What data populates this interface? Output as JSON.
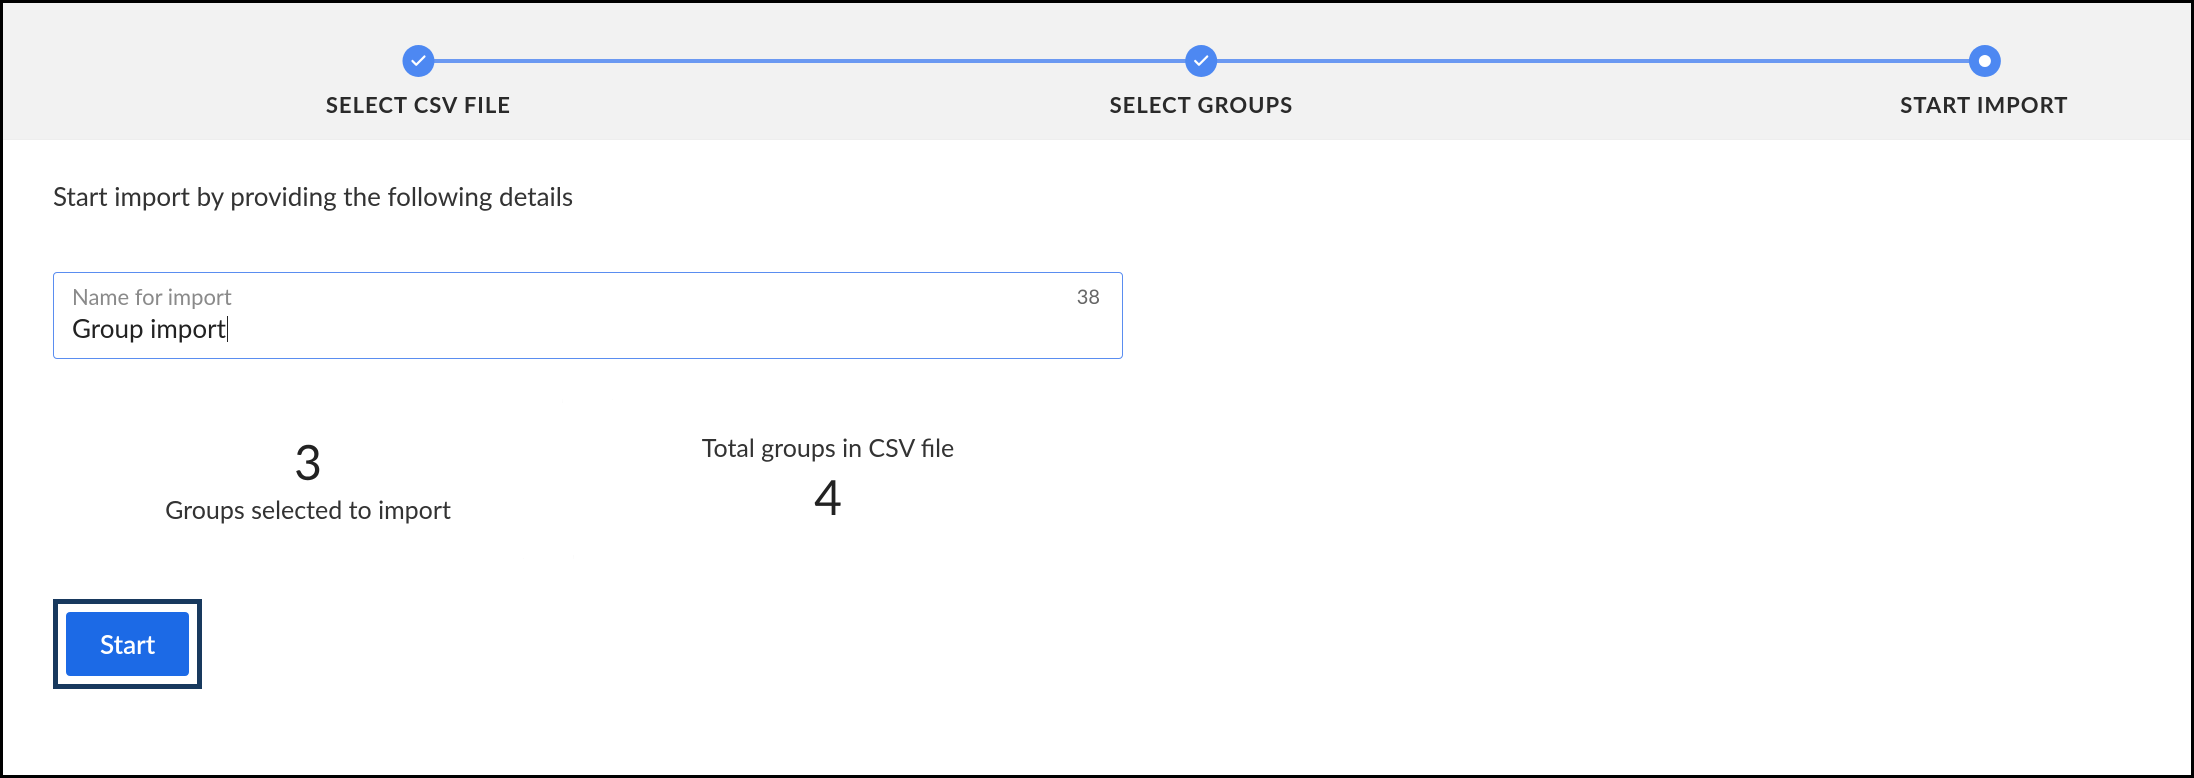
{
  "colors": {
    "accent": "#4d88f2",
    "line": "#6b99f2",
    "button": "#1c6ae6",
    "button_outline": "#18395e"
  },
  "stepper": {
    "steps": [
      {
        "label": "SELECT CSV FILE",
        "state": "done"
      },
      {
        "label": "SELECT GROUPS",
        "state": "done"
      },
      {
        "label": "START IMPORT",
        "state": "current"
      }
    ]
  },
  "instruction": "Start import by providing the following details",
  "name_input": {
    "label": "Name for import",
    "value": "Group import",
    "remaining": "38"
  },
  "stats": {
    "selected": {
      "value": "3",
      "label": "Groups selected to import"
    },
    "total": {
      "value": "4",
      "label": "Total groups in CSV file"
    }
  },
  "buttons": {
    "start": "Start"
  }
}
